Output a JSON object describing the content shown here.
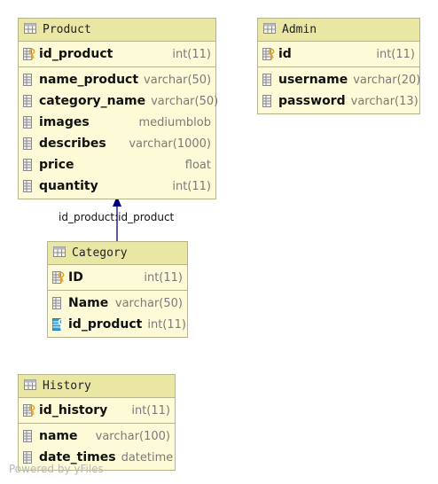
{
  "tables": [
    {
      "id": "product",
      "title": "Product",
      "sections": [
        [
          {
            "name": "id_product",
            "type": "int(11)",
            "icon": "primary-key-icon"
          }
        ],
        [
          {
            "name": "name_product",
            "type": "varchar(50)",
            "icon": "column-icon"
          },
          {
            "name": "category_name",
            "type": "varchar(50)",
            "icon": "column-icon"
          },
          {
            "name": "images",
            "type": "mediumblob",
            "icon": "column-icon"
          },
          {
            "name": "describes",
            "type": "varchar(1000)",
            "icon": "column-icon"
          },
          {
            "name": "price",
            "type": "float",
            "icon": "column-icon"
          },
          {
            "name": "quantity",
            "type": "int(11)",
            "icon": "column-icon"
          }
        ]
      ]
    },
    {
      "id": "admin",
      "title": "Admin",
      "sections": [
        [
          {
            "name": "id",
            "type": "int(11)",
            "icon": "primary-key-icon"
          }
        ],
        [
          {
            "name": "username",
            "type": "varchar(20)",
            "icon": "column-icon"
          },
          {
            "name": "password",
            "type": "varchar(13)",
            "icon": "column-icon"
          }
        ]
      ]
    },
    {
      "id": "category",
      "title": "Category",
      "sections": [
        [
          {
            "name": "ID",
            "type": "int(11)",
            "icon": "primary-key-icon"
          }
        ],
        [
          {
            "name": "Name",
            "type": "varchar(50)",
            "icon": "column-icon"
          },
          {
            "name": "id_product",
            "type": "int(11)",
            "icon": "foreign-key-icon"
          }
        ]
      ]
    },
    {
      "id": "history",
      "title": "History",
      "sections": [
        [
          {
            "name": "id_history",
            "type": "int(11)",
            "icon": "primary-key-icon"
          }
        ],
        [
          {
            "name": "name",
            "type": "varchar(100)",
            "icon": "column-icon"
          },
          {
            "name": "date_times",
            "type": "datetime",
            "icon": "column-icon"
          }
        ]
      ]
    }
  ],
  "relations": [
    {
      "from": "category",
      "to": "product",
      "label": "id_product:id_product"
    }
  ],
  "footer": "Powered by yFiles",
  "colors": {
    "body": "#fdfbd7",
    "header": "#eae7a5",
    "border": "#b5b48a",
    "arrow": "#00007a",
    "key": "#e0a32b",
    "foreign_key": "#2a9fd6"
  }
}
